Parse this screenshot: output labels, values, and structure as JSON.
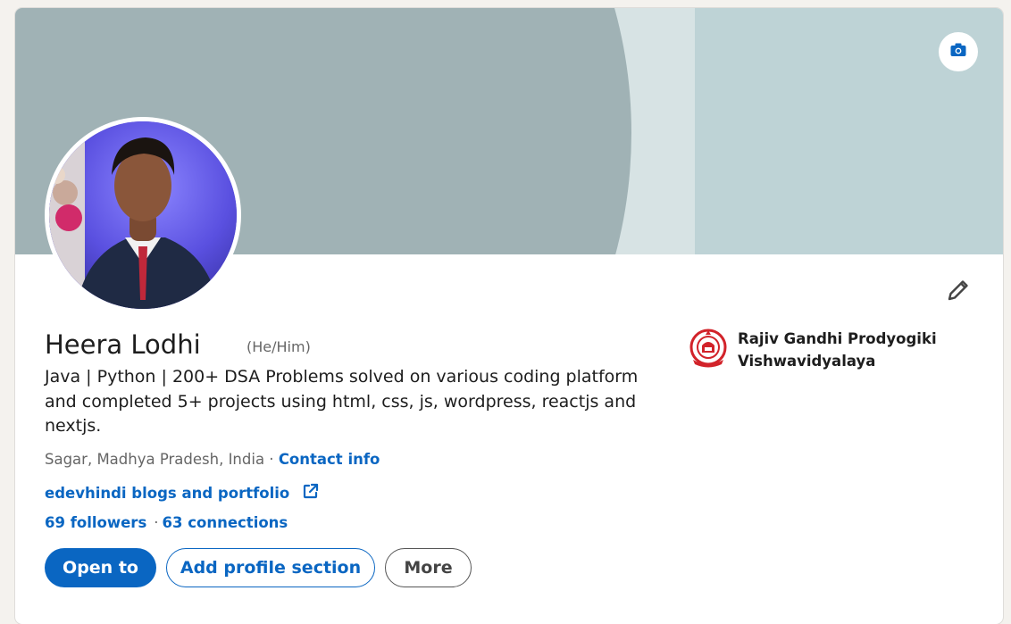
{
  "profile": {
    "name": "Heera Lodhi",
    "pronouns": "(He/Him)",
    "headline": "Java | Python | 200+ DSA Problems solved on various coding platform and completed 5+ projects using html, css, js, wordpress, reactjs and nextjs.",
    "location": "Sagar, Madhya Pradesh, India",
    "location_separator": " · ",
    "contact_info_label": "Contact info",
    "website_label": "edevhindi blogs and portfolio",
    "followers_label": "69 followers",
    "network_separator": "·",
    "connections_label": "63 connections"
  },
  "actions": {
    "open_to_label": "Open to",
    "add_section_label": "Add profile section",
    "more_label": "More"
  },
  "education": {
    "school_name": "Rajiv Gandhi Prodyogiki Vishwavidyalaya"
  },
  "icons": {
    "banner_edit": "camera-icon",
    "intro_edit": "pencil-icon",
    "website_external": "external-link-icon",
    "school_logo": "university-logo"
  },
  "colors": {
    "brand_blue": "#0a66c2",
    "banner_light": "#bed3d6",
    "banner_dark": "#a0b2b5",
    "banner_strip": "#d7e3e4",
    "text_primary": "#1d1d1d",
    "text_secondary": "#666666"
  }
}
